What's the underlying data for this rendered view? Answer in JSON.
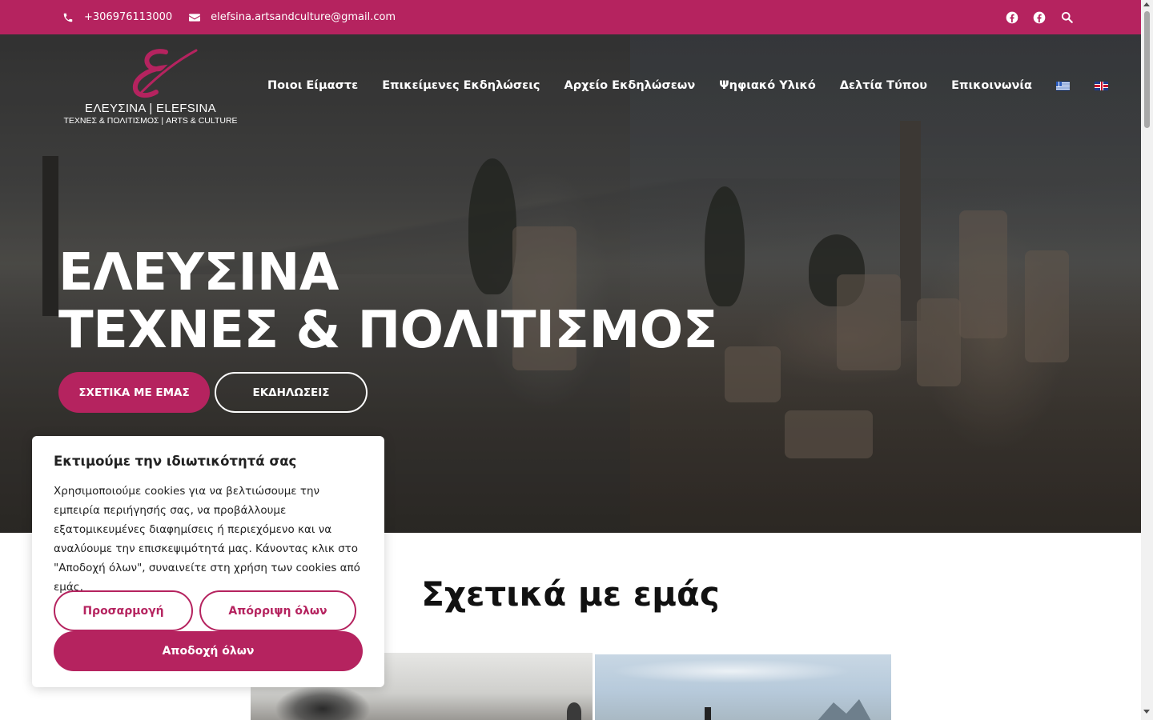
{
  "topbar": {
    "phone": "+306976113000",
    "email": "elefsina.artsandculture@gmail.com",
    "social_icons": [
      "facebook-icon",
      "facebook-icon",
      "search-icon"
    ]
  },
  "logo": {
    "line1": "ΕΛΕΥΣΙΝΑ | ELEFSINA",
    "line2": "ΤΕΧΝΕΣ & ΠΟΛΙΤΙΣΜΟΣ | ARTS & CULTURE"
  },
  "nav": {
    "items": [
      {
        "label": "Ποιοι Είμαστε"
      },
      {
        "label": "Επικείμενες Εκδηλώσεις"
      },
      {
        "label": "Αρχείο Εκδηλώσεων"
      },
      {
        "label": "Ψηφιακό Υλικό"
      },
      {
        "label": "Δελτία Τύπου"
      },
      {
        "label": "Επικοινωνία"
      }
    ],
    "languages": [
      "greek-flag-icon",
      "uk-flag-icon"
    ]
  },
  "hero": {
    "title_line1": "ΕΛΕΥΣΙΝΑ",
    "title_line2": "ΤΕΧΝΕΣ & ΠΟΛΙΤΙΣΜΟΣ",
    "primary_button": "ΣΧΕΤΙΚΑ ΜΕ ΕΜΑΣ",
    "secondary_button": "ΕΚΔΗΛΩΣΕΙΣ"
  },
  "about": {
    "heading": "Σχετικά με εμάς"
  },
  "cookie": {
    "title": "Εκτιμούμε την ιδιωτικότητά σας",
    "text": "Χρησιμοποιούμε cookies για να βελτιώσουμε την εμπειρία περιήγησής σας, να προβάλλουμε εξατομικευμένες διαφημίσεις ή περιεχόμενο και να αναλύουμε την επισκεψιμότητά μας. Κάνοντας κλικ στο \"Αποδοχή όλων\", συναινείτε στη χρήση των cookies από εμάς.",
    "customize": "Προσαρμογή",
    "reject": "Απόρριψη όλων",
    "accept": "Αποδοχή όλων"
  },
  "colors": {
    "brand": "#b5235f",
    "heading": "#111111",
    "text": "#212121"
  }
}
